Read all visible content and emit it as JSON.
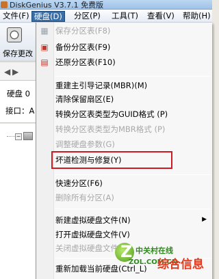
{
  "window": {
    "title": "DiskGenius V3.7.1 免费版"
  },
  "menubar": {
    "items": [
      {
        "label": "文件(F)"
      },
      {
        "label": "硬盘(D)"
      },
      {
        "label": "分区(P)"
      },
      {
        "label": "工具(T)"
      },
      {
        "label": "查看(V)"
      },
      {
        "label": "帮助(H)"
      }
    ]
  },
  "background": {
    "save_label": "保存更改",
    "nav_back": "◀",
    "nav_forward": "▶",
    "disk_label": "硬盘 0",
    "interface_label": "接口：A"
  },
  "disk_menu": {
    "items": [
      {
        "label": "保存分区表(F8)",
        "disabled": true,
        "icon": "save-partition-icon"
      },
      {
        "label": "备份分区表(F9)",
        "disabled": false,
        "icon": "backup-partition-icon"
      },
      {
        "label": "还原分区表(F10)",
        "disabled": false,
        "icon": "restore-partition-icon"
      },
      {
        "label": "重建主引导记录(MBR)(M)",
        "disabled": false
      },
      {
        "label": "清除保留扇区(E)",
        "disabled": false
      },
      {
        "label": "转换分区表类型为GUID格式 (P)",
        "disabled": false
      },
      {
        "label": "转换分区表类型为MBR格式 (P)",
        "disabled": true
      },
      {
        "label": "调整硬盘参数(G)",
        "disabled": true
      },
      {
        "label": "坏道检测与修复(Y)",
        "disabled": false
      },
      {
        "label": "快速分区(F6)",
        "disabled": false
      },
      {
        "label": "删除所有分区(A)",
        "disabled": true
      },
      {
        "label": "新建虚拟硬盘文件(N)",
        "disabled": false
      },
      {
        "label": "打开虚拟硬盘文件(V)",
        "disabled": false
      },
      {
        "label": "关闭虚拟硬盘文件(C)",
        "disabled": true
      },
      {
        "label": "重新加载当前硬盘(Ctrl_L)",
        "disabled": false
      }
    ]
  },
  "watermark": {
    "line1": "中关村在线",
    "line2": "ZOL.COM.CN",
    "line3": "综合信息"
  },
  "colors": {
    "highlight_box": "#d01820",
    "menu_active": "#3a6ea5",
    "disabled_text": "#a8a8a8"
  }
}
